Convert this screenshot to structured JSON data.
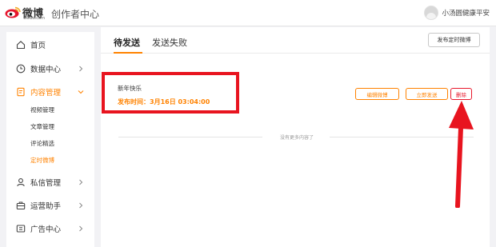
{
  "header": {
    "logo_text": "微博",
    "logo_sub": "weibo.com",
    "title": "创作者中心",
    "user_name": "小汤圆健康平安"
  },
  "sidebar": {
    "items": [
      {
        "label": "首页",
        "icon": "home-icon",
        "expandable": false
      },
      {
        "label": "数据中心",
        "icon": "clock-icon",
        "expandable": true
      },
      {
        "label": "内容管理",
        "icon": "document-icon",
        "expandable": true,
        "active": true
      },
      {
        "label": "私信管理",
        "icon": "user-icon",
        "expandable": true
      },
      {
        "label": "运营助手",
        "icon": "briefcase-icon",
        "expandable": true
      },
      {
        "label": "广告中心",
        "icon": "ad-icon",
        "expandable": true
      }
    ],
    "content_sub_items": [
      {
        "label": "视频管理"
      },
      {
        "label": "文章管理"
      },
      {
        "label": "评论精选"
      },
      {
        "label": "定时微博",
        "active": true
      }
    ]
  },
  "main": {
    "tabs": [
      {
        "label": "待发送",
        "active": true
      },
      {
        "label": "发送失败"
      }
    ],
    "publish_button": "发布定时微博",
    "post": {
      "text": "新年快乐",
      "time_label": "发布时间：3月16日 03:04:00"
    },
    "actions": {
      "edit": "编辑微博",
      "send_now": "立即发送",
      "delete": "删除"
    },
    "empty_hint": "没有更多内容了"
  },
  "colors": {
    "accent": "#ff8200",
    "danger": "#e8182b",
    "annotation": "#e8141f"
  }
}
